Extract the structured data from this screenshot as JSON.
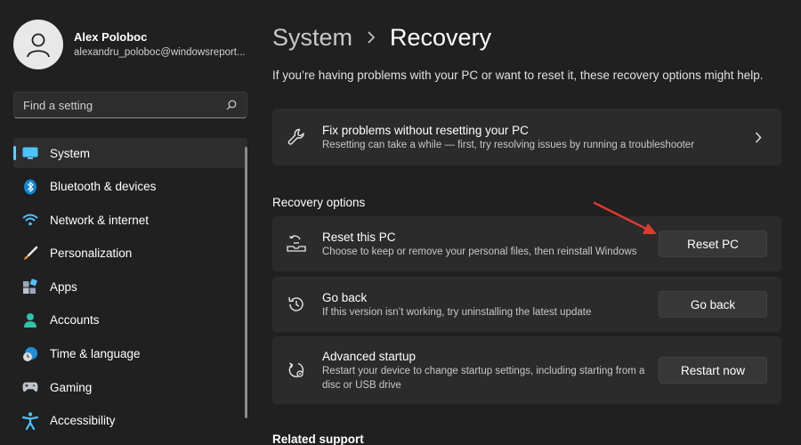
{
  "profile": {
    "name": "Alex Poloboc",
    "email": "alexandru_poloboc@windowsreport..."
  },
  "search": {
    "placeholder": "Find a setting",
    "icon": "search-icon"
  },
  "sidebar": {
    "accent": "#60cdff",
    "items": [
      {
        "label": "System",
        "icon": "system-icon",
        "active": true
      },
      {
        "label": "Bluetooth & devices",
        "icon": "bluetooth-icon"
      },
      {
        "label": "Network & internet",
        "icon": "wifi-icon"
      },
      {
        "label": "Personalization",
        "icon": "brush-icon"
      },
      {
        "label": "Apps",
        "icon": "apps-icon"
      },
      {
        "label": "Accounts",
        "icon": "accounts-icon"
      },
      {
        "label": "Time & language",
        "icon": "clock-globe-icon"
      },
      {
        "label": "Gaming",
        "icon": "gamepad-icon"
      },
      {
        "label": "Accessibility",
        "icon": "accessibility-icon"
      }
    ]
  },
  "header": {
    "parent": "System",
    "current": "Recovery",
    "intro": "If you’re having problems with your PC or want to reset it, these recovery options might help."
  },
  "fix_card": {
    "title": "Fix problems without resetting your PC",
    "desc": "Resetting can take a while — first, try resolving issues by running a troubleshooter",
    "icon": "wrench-icon"
  },
  "recovery": {
    "heading": "Recovery options",
    "options": [
      {
        "title": "Reset this PC",
        "desc": "Choose to keep or remove your personal files, then reinstall Windows",
        "button": "Reset PC",
        "icon": "reset-pc-icon"
      },
      {
        "title": "Go back",
        "desc": "If this version isn’t working, try uninstalling the latest update",
        "button": "Go back",
        "icon": "history-icon"
      },
      {
        "title": "Advanced startup",
        "desc": "Restart your device to change startup settings, including starting from a disc or USB drive",
        "button": "Restart now",
        "icon": "advanced-startup-icon"
      }
    ]
  },
  "related": {
    "heading": "Related support"
  },
  "annotation": {
    "arrow_color": "#e03a2f"
  }
}
